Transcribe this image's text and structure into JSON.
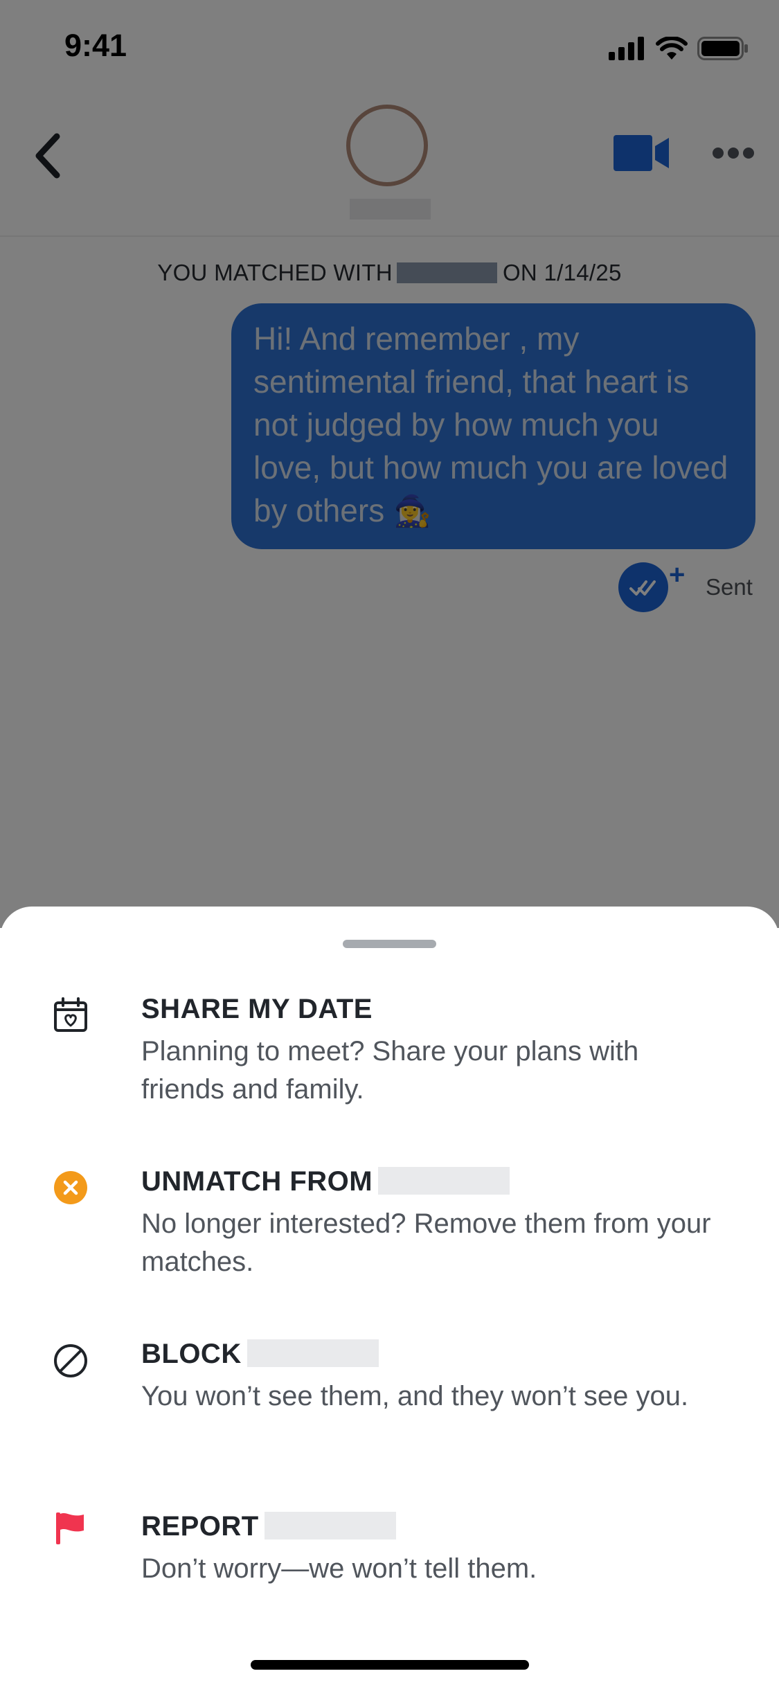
{
  "status_bar": {
    "time": "9:41",
    "icons": [
      "cellular-signal-icon",
      "wifi-icon",
      "battery-icon"
    ]
  },
  "header": {
    "back_icon": "chevron-left-icon",
    "video_icon": "video-camera-icon",
    "more_icon": "more-dots-icon"
  },
  "conversation": {
    "match_notice_prefix": "YOU MATCHED WITH",
    "match_notice_suffix": "ON 1/14/25",
    "message": {
      "text": "Hi! And remember , my sentimental friend, that heart is not judged by how much you love, but how much you are loved by others",
      "emoji": "🧙‍♀️"
    },
    "receipt_plus": "+",
    "status": "Sent"
  },
  "sheet": {
    "actions": [
      {
        "icon": "calendar-heart-icon",
        "title": "SHARE MY DATE",
        "description": "Planning to meet? Share your plans with friends and family."
      },
      {
        "icon": "unmatch-x-icon",
        "title": "UNMATCH FROM",
        "description": "No longer interested? Remove them from your matches."
      },
      {
        "icon": "block-icon",
        "title": "BLOCK",
        "description": "You won’t see them, and they won’t see you."
      },
      {
        "icon": "flag-icon",
        "title": "REPORT",
        "description": "Don’t worry—we won’t tell them."
      }
    ]
  },
  "colors": {
    "accent_blue": "#1c65d6",
    "unmatch_orange": "#f39a1a",
    "report_red": "#f0344f"
  }
}
